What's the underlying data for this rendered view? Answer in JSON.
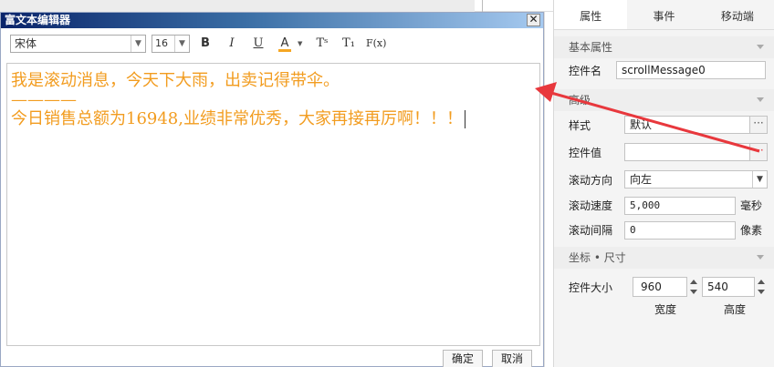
{
  "dialog": {
    "title": "富文本编辑器",
    "close_label": "✕",
    "toolbar": {
      "font_family": "宋体",
      "font_size": "16",
      "bold_label": "B",
      "italic_label": "I",
      "underline_label": "U",
      "color_label": "A",
      "superscript_label": "Tˢ",
      "subscript_label": "T₁",
      "clear_format_label": "F(x)",
      "font_color": "#f5a623"
    },
    "content": {
      "line1": "我是滚动消息，今天下大雨，出卖记得带伞。",
      "line2": "————",
      "line3": "今日销售总额为16948,业绩非常优秀，大家再接再厉啊！！！",
      "text_color": "#f29c1f"
    },
    "ok_label": "确定",
    "cancel_label": "取消"
  },
  "panel": {
    "tabs": [
      {
        "label": "属性",
        "active": true
      },
      {
        "label": "事件",
        "active": false
      },
      {
        "label": "移动端",
        "active": false
      }
    ],
    "basic_section": "基本属性",
    "control_name_label": "控件名",
    "control_name_value": "scrollMessage0",
    "advanced_section": "高级",
    "style_label": "样式",
    "style_value": "默认",
    "control_value_label": "控件值",
    "control_value": "",
    "direction_label": "滚动方向",
    "direction_value": "向左",
    "speed_label": "滚动速度",
    "speed_value": "5,000",
    "speed_unit": "毫秒",
    "interval_label": "滚动间隔",
    "interval_value": "0",
    "interval_unit": "像素",
    "coord_section": "坐标 • 尺寸",
    "size_label": "控件大小",
    "width_value": "960",
    "height_value": "540",
    "width_label": "宽度",
    "height_label": "高度",
    "dots_label": "···"
  },
  "annotation": {
    "arrow_color": "#e8383d"
  }
}
